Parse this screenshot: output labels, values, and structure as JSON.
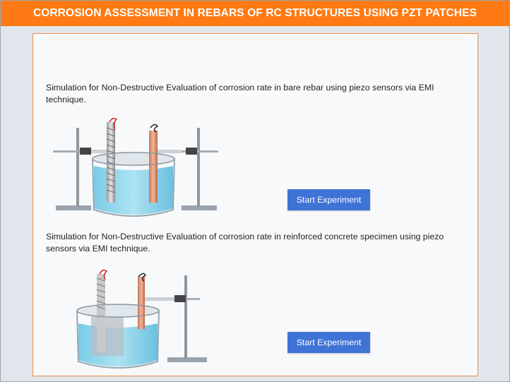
{
  "header": {
    "title": "CORROSION ASSESSMENT IN REBARS OF RC STRUCTURES USING PZT PATCHES"
  },
  "experiments": [
    {
      "description": "Simulation for Non-Destructive Evaluation of corrosion rate in bare rebar using piezo sensors via EMI technique.",
      "button_label": "Start Experiment",
      "illustration": "beaker-with-two-rebars-and-clamp-stands"
    },
    {
      "description": "Simulation for Non-Destructive Evaluation of corrosion rate in reinforced concrete specimen using piezo sensors via EMI technique.",
      "button_label": "Start Experiment",
      "illustration": "beaker-with-concrete-specimen-and-clamp-stand"
    }
  ],
  "colors": {
    "header_bg": "#ff7a14",
    "button_bg": "#3f73d6",
    "panel_border": "#f08a3c",
    "water": "#8fd3ea"
  }
}
